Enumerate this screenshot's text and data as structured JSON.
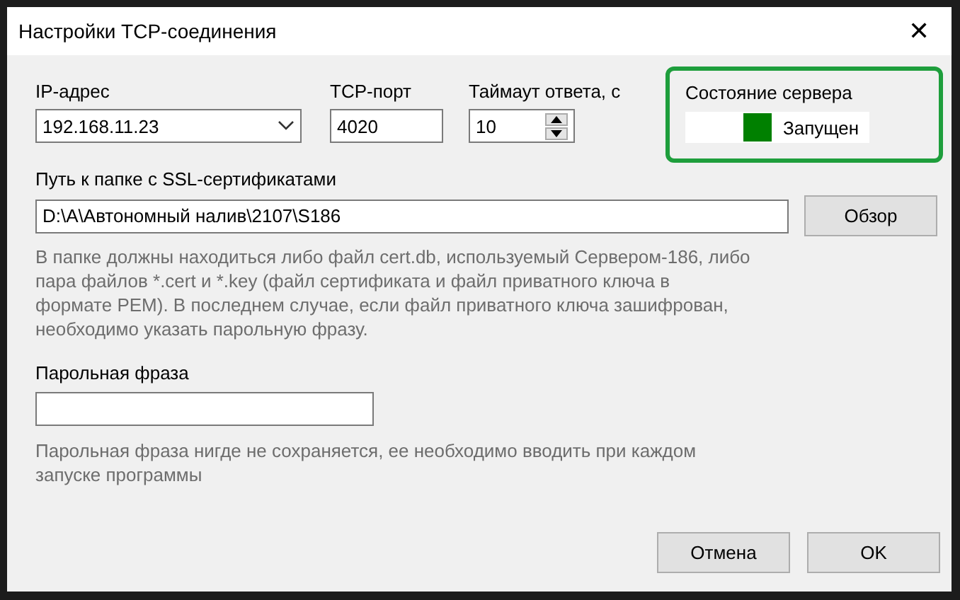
{
  "window": {
    "title": "Настройки TCP-соединения",
    "close": "✕"
  },
  "ip": {
    "label": "IP-адрес",
    "value": "192.168.11.23"
  },
  "port": {
    "label": "TCP-порт",
    "value": "4020"
  },
  "timeout": {
    "label": "Таймаут ответа, с",
    "value": "10"
  },
  "server_status": {
    "label": "Состояние сервера",
    "on": true,
    "text": "Запущен"
  },
  "cert_path": {
    "label": "Путь к папке с SSL-сертификатами",
    "value": "D:\\А\\Автономный налив\\2107\\S186",
    "browse": "Обзор",
    "hint": "В папке должны находиться либо файл cert.db, используемый Сервером-186, либо пара файлов *.cert и *.key (файл сертификата и файл приватного ключа в формате PEM). В последнем случае, если файл приватного ключа зашифрован, необходимо указать парольную фразу."
  },
  "passphrase": {
    "label": "Парольная фраза",
    "hint": "Парольная фраза нигде не сохраняется, ее необходимо вводить при каждом запуске программы"
  },
  "buttons": [
    "Отмена",
    "OK"
  ]
}
